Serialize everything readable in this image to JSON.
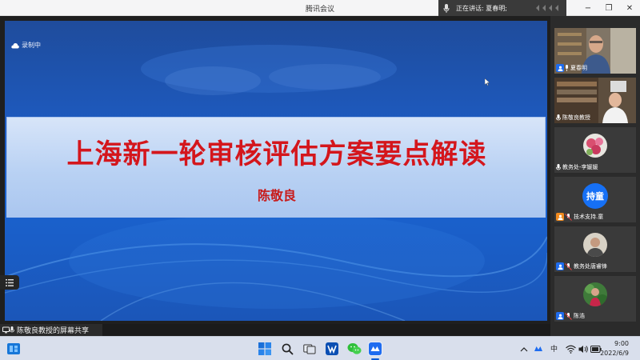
{
  "window": {
    "title": "腾讯会议",
    "speaking_text": "正在讲话: 夏春明;",
    "controls": {
      "minimize": "−",
      "restore": "❐",
      "close": "✕"
    }
  },
  "share": {
    "recording_label": "录制中",
    "sharing_label": "陈敬良教授的屏幕共享",
    "slide": {
      "title": "上海新一轮审核评估方案要点解读",
      "author": "陈敬良"
    }
  },
  "participants": [
    {
      "name": "夏春明",
      "icon": "video-person",
      "badge": "host"
    },
    {
      "name": "陈敬良教授",
      "icon": "video-person",
      "badge": "mic"
    },
    {
      "name": "教务处-李媛媛",
      "icon": "flower-avatar",
      "badge": "mic"
    },
    {
      "name": "技术支持.童",
      "icon": "text-avatar",
      "avatar_text": "持童",
      "badge": "co-host"
    },
    {
      "name": "教务处唐睿锋",
      "icon": "photo-avatar",
      "badge": "host"
    },
    {
      "name": "陈浩",
      "icon": "photo-avatar",
      "badge": "host"
    }
  ],
  "taskbar": {
    "ime": "中",
    "time": "9:00",
    "date": "2022/6/9"
  },
  "colors": {
    "slide_blue": "#1d5cc4",
    "title_red": "#d4161c",
    "host_blue": "#1e6cf0",
    "cohost_orange": "#f08a1e"
  }
}
